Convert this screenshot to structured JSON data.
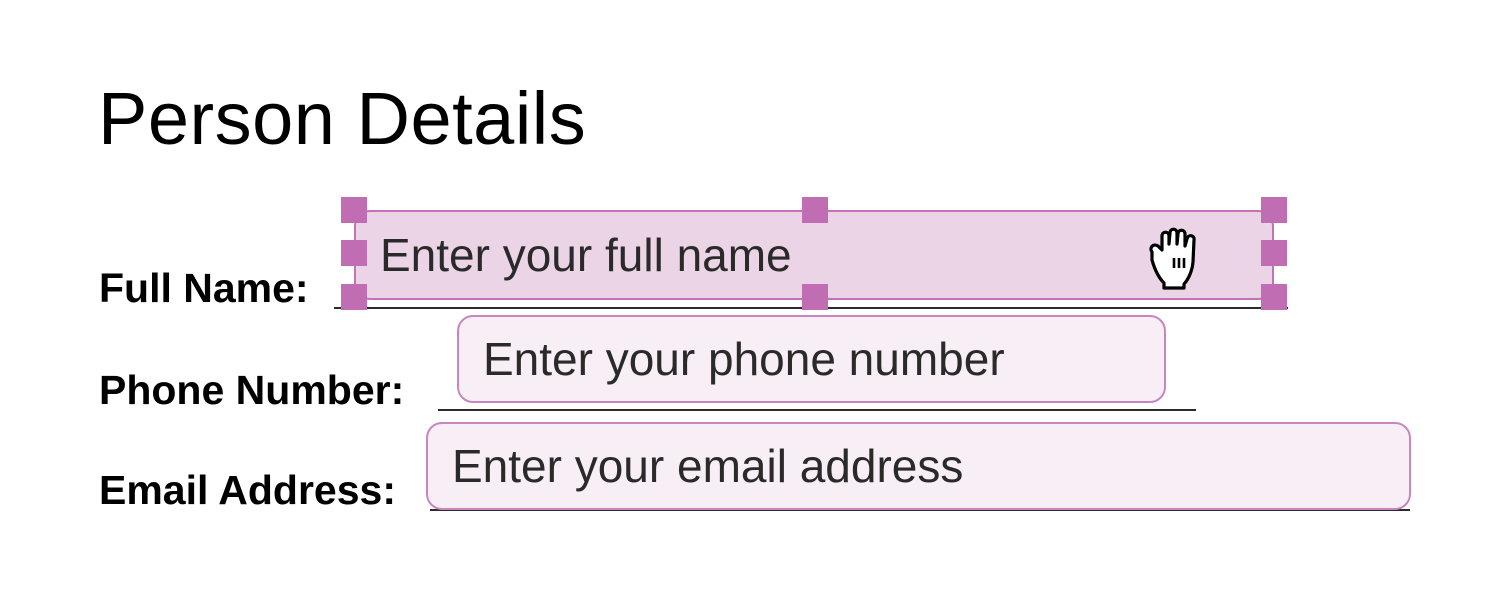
{
  "form": {
    "title": "Person Details",
    "fields": [
      {
        "label": "Full Name:",
        "placeholder": "Enter your full name"
      },
      {
        "label": "Phone Number:",
        "placeholder": "Enter your phone number"
      },
      {
        "label": "Email Address:",
        "placeholder": "Enter your email address"
      }
    ]
  },
  "colors": {
    "field_border": "#c985c0",
    "field_fill": "#f8eef6",
    "selected_fill": "#ebd4e6",
    "handle": "#c06db3"
  },
  "icons": {
    "cursor": "grab-hand-cursor-icon",
    "handles": "resize-handle"
  }
}
